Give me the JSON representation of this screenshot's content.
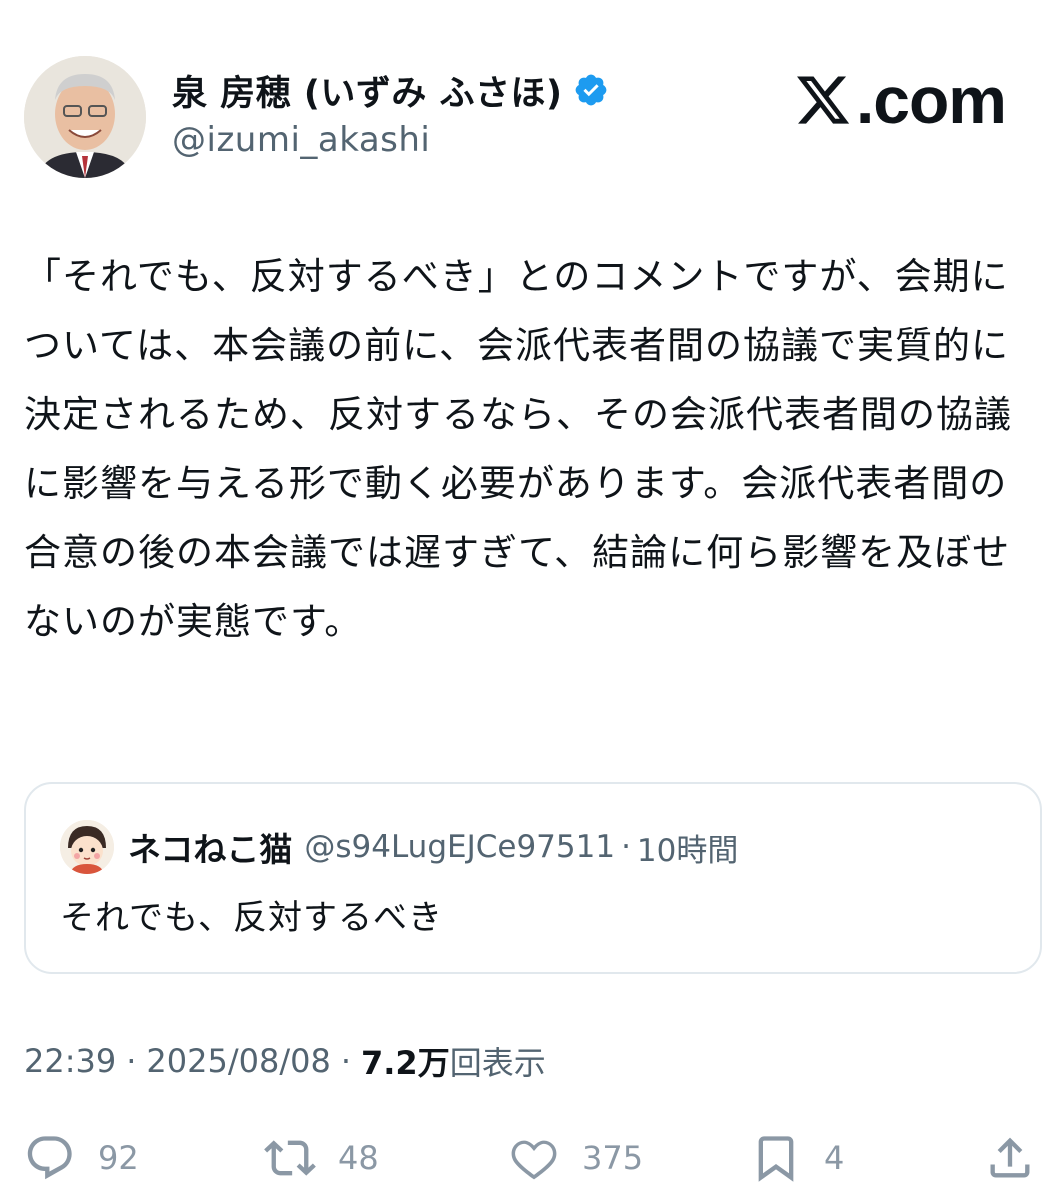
{
  "author": {
    "display_name": "泉 房穂 (いずみ ふさほ)",
    "handle": "@izumi_akashi",
    "verified": true
  },
  "brand": {
    "label": ".com",
    "icon": "x-logo-icon"
  },
  "tweet": {
    "text": "「それでも、反対するべき」とのコメントですが、会期については、本会議の前に、会派代表者間の協議で実質的に決定されるため、反対するなら、その会派代表者間の協議に影響を与える形で動く必要があります。会派代表者間の合意の後の本会議では遅すぎて、結論に何ら影響を及ぼせないのが実態です。"
  },
  "quote": {
    "display_name": "ネコねこ猫",
    "handle": "@s94LugEJCe97511",
    "separator": "·",
    "time": "10時間",
    "text": "それでも、反対するべき"
  },
  "meta": {
    "time": "22:39",
    "separator": "·",
    "date": "2025/08/08",
    "views_number": "7.2万",
    "views_label": "回表示"
  },
  "actions": {
    "reply_count": "92",
    "retweet_count": "48",
    "like_count": "375",
    "bookmark_count": "4"
  },
  "colors": {
    "text": "#0f1419",
    "secondary": "#536471",
    "icon": "#8b98a5",
    "verified": "#1d9bf0",
    "border": "#e1e8ed"
  }
}
